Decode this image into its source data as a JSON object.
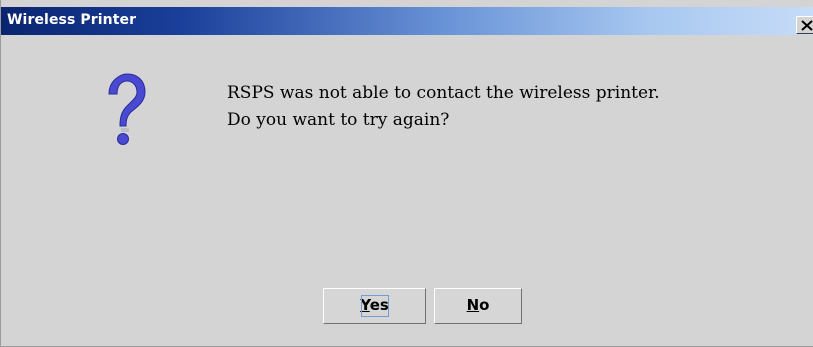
{
  "window": {
    "title": "Wireless Printer",
    "close_glyph": "X"
  },
  "icon": {
    "name": "question-icon",
    "glyph": "?",
    "color": "#3c3cc8"
  },
  "message": {
    "line1": "RSPS was not able to contact the wireless printer.",
    "line2": "Do you want to try again?"
  },
  "buttons": {
    "yes": {
      "mnemonic": "Y",
      "rest": "es"
    },
    "no": {
      "mnemonic": "N",
      "rest": "o"
    }
  },
  "colors": {
    "dialog_background": "#d4d4d4",
    "titlebar_start": "#0a2470",
    "titlebar_end": "#c6dcf8"
  }
}
